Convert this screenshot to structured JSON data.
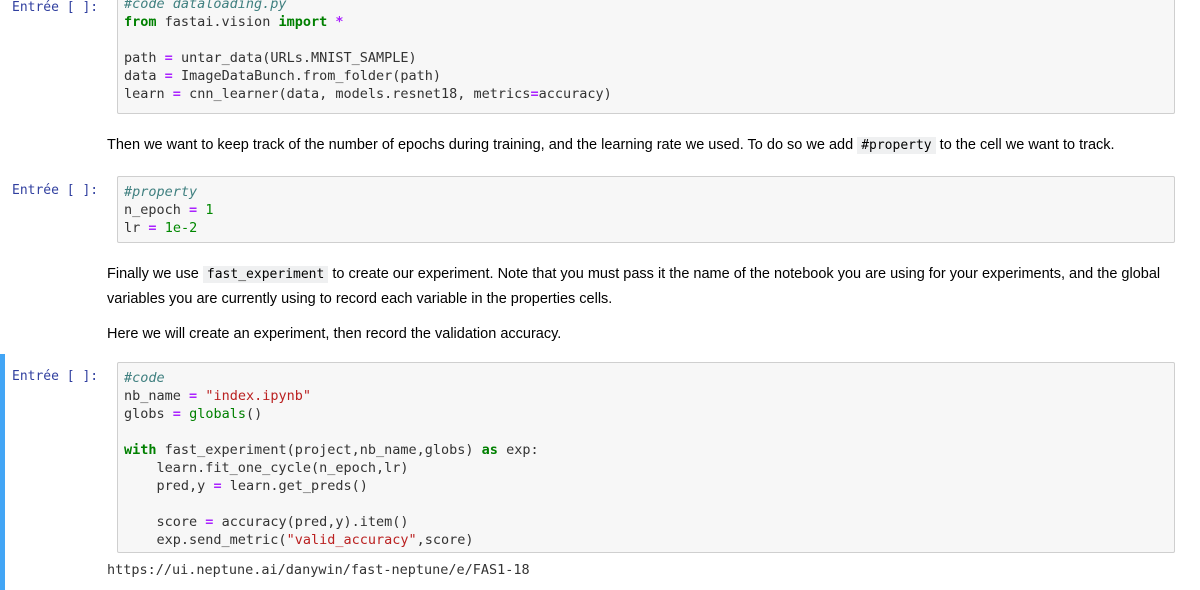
{
  "prompt_label": "Entrée [ ]:",
  "cell1": {
    "line1": "#code dataloading.py",
    "import_from": "from",
    "import_module": "fastai.vision",
    "import_kw": "import",
    "import_star": "*",
    "path_var": "path",
    "path_call": "untar_data(URLs.MNIST_SAMPLE)",
    "data_var": "data",
    "data_call": "ImageDataBunch.from_folder(path)",
    "learn_var": "learn",
    "learn_call_a": "cnn_learner(data, models.resnet18, metrics",
    "learn_call_b": "accuracy)"
  },
  "md1": {
    "text_a": "Then we want to keep track of the number of epochs during training, and the learning rate we used. To do so we add",
    "code": "#property",
    "text_b": "to the cell we want to track."
  },
  "cell2": {
    "line1": "#property",
    "nepoch_var": "n_epoch",
    "nepoch_val": "1",
    "lr_var": "lr",
    "lr_val": "1e-2"
  },
  "md2": {
    "text_a": "Finally we use",
    "code": "fast_experiment",
    "text_b": "to create our experiment. Note that you must pass it the name of the notebook you are using for your experiments, and the global variables you are currently using to record each variable in the properties cells.",
    "text_c": "Here we will create an experiment, then record the validation accuracy."
  },
  "cell3": {
    "line1": "#code",
    "nb_var": "nb_name",
    "nb_val": "\"index.ipynb\"",
    "globs_var": "globs",
    "globs_call": "globals",
    "globs_paren": "()",
    "with_kw": "with",
    "with_call": "fast_experiment(project,nb_name,globs)",
    "as_kw": "as",
    "as_var": "exp:",
    "fit_line": "learn.fit_one_cycle(n_epoch,lr)",
    "pred_var": "pred,y",
    "pred_call": "learn.get_preds()",
    "score_var": "score",
    "score_call": "accuracy(pred,y).item()",
    "send_a": "exp.send_metric(",
    "send_str": "\"valid_accuracy\"",
    "send_b": ",score)"
  },
  "output_url": "https://ui.neptune.ai/danywin/fast-neptune/e/FAS1-18"
}
